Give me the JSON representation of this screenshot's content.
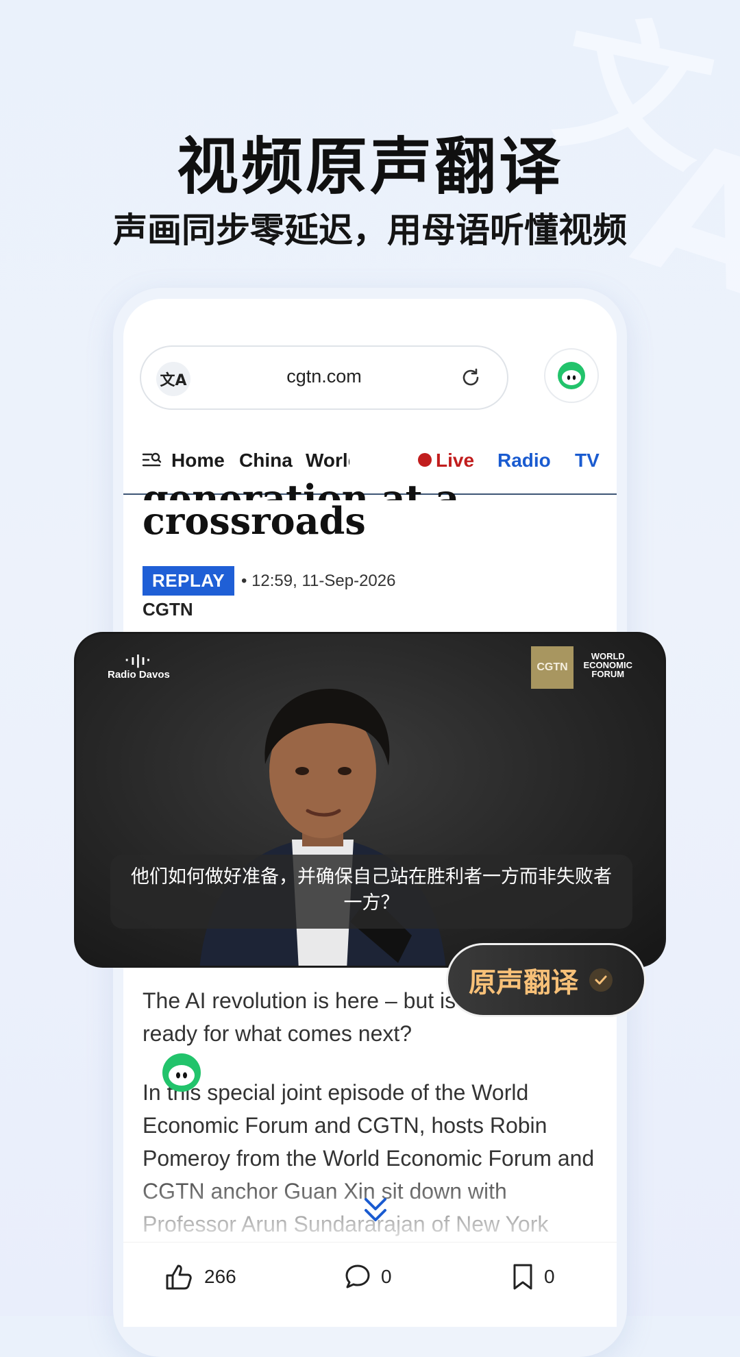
{
  "promo": {
    "headline": "视频原声翻译",
    "subline": "声画同步零延迟，用母语听懂视频"
  },
  "browser": {
    "url": "cgtn.com",
    "translate_icon_text": "文A"
  },
  "nav": {
    "items": [
      "Home",
      "China",
      "World"
    ],
    "live": "Live",
    "radio": "Radio",
    "tv": "TV"
  },
  "article": {
    "title_cut": "generation at a",
    "title": "crossroads",
    "replay": "REPLAY",
    "date": "• 12:59, 11-Sep-2026",
    "source": "CGTN",
    "para1": "The AI revolution is here – but is the world ready for what comes next?",
    "para2": "In this special joint episode of the World Economic Forum and CGTN, hosts Robin Pomeroy from the World Economic Forum and CGTN anchor Guan Xin sit down with Professor Arun Sundararajan of New York"
  },
  "video": {
    "radio_logo": "Radio Davos",
    "cgtn_logo": "CGTN",
    "wef_logo_lines": [
      "WORLD",
      "ECONOMIC",
      "FORUM"
    ],
    "subtitle": "他们如何做好准备，并确保自己站在胜利者一方而非失败者一方？"
  },
  "translate_badge": {
    "label": "原声翻译"
  },
  "actions": {
    "likes": "266",
    "comments": "0",
    "bookmarks": "0"
  },
  "colors": {
    "brand_blue": "#1f5fd6",
    "live_red": "#c11d1d",
    "badge_text": "#f7c078",
    "mascot_green": "#22c36b"
  }
}
